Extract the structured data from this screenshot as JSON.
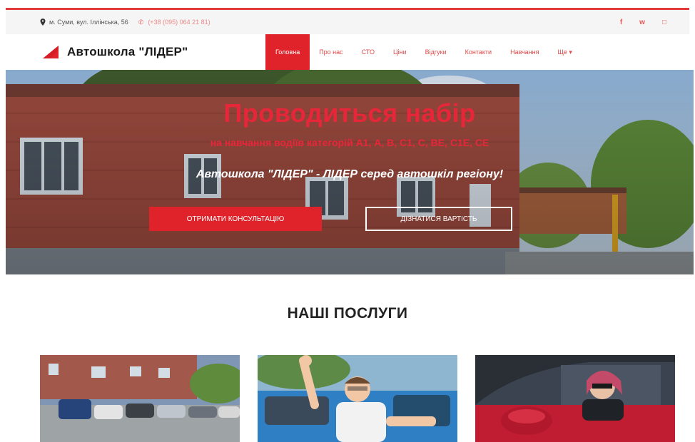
{
  "colors": {
    "accent": "#e0232a",
    "accent_text": "#e8263a",
    "topbar_bg": "#f5f5f5"
  },
  "topbar": {
    "address": "м. Суми, вул. Іллінська, 56",
    "phone": "(+38 (095) 064 21 81)",
    "socials": [
      "f",
      "w",
      "□"
    ]
  },
  "logo": {
    "text": "Автошкола \"ЛІДЕР\""
  },
  "nav": {
    "items": [
      {
        "label": "Головна",
        "active": true
      },
      {
        "label": "Про нас"
      },
      {
        "label": "СТО"
      },
      {
        "label": "Ціни"
      },
      {
        "label": "Відгуки"
      },
      {
        "label": "Контакти"
      },
      {
        "label": "Навчання"
      },
      {
        "label": "Ще ▾"
      }
    ]
  },
  "hero": {
    "title": "Проводиться набір",
    "subtitle": "на навчання водіїв категорій А1, А, В, С1, С, ВЕ, С1Е, СЕ",
    "tagline": "Автошкола \"ЛІДЕР\" - ЛІДЕР серед автошкіл регіону!",
    "primary_button": "Отримати консультацію",
    "secondary_button": "Дізнатися вартість"
  },
  "services": {
    "title": "НАШІ ПОСЛУГИ",
    "cards": [
      {
        "icon": "parking-lot-photo"
      },
      {
        "icon": "happy-driver-photo"
      },
      {
        "icon": "woman-in-car-photo"
      }
    ]
  }
}
